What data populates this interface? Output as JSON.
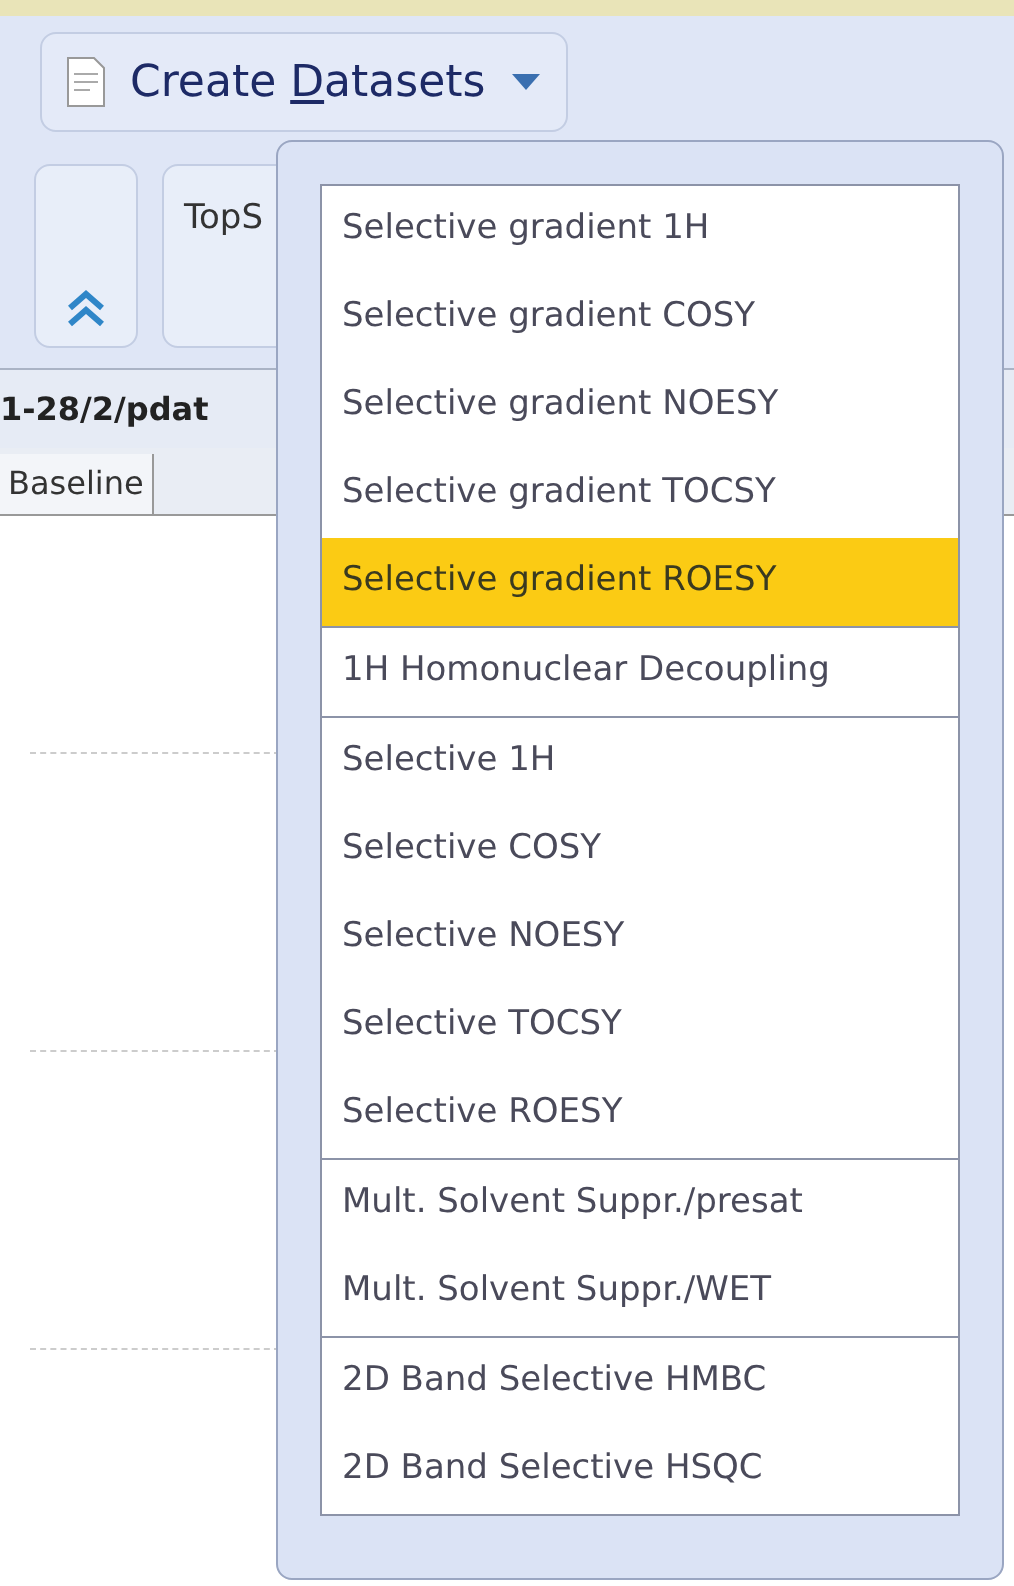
{
  "menu_button": {
    "title_before": "Create ",
    "mnemonic": "D",
    "title_after": "atasets"
  },
  "toolbar": {
    "panel_label": "TopS"
  },
  "path": "1-28/2/pdat",
  "tabs": [
    {
      "label": "Baseline",
      "selected": false
    }
  ],
  "menu": {
    "sections": [
      {
        "items": [
          {
            "label": "Selective gradient 1H",
            "selected": false
          },
          {
            "label": "Selective gradient COSY",
            "selected": false
          },
          {
            "label": "Selective gradient NOESY",
            "selected": false
          },
          {
            "label": "Selective gradient TOCSY",
            "selected": false
          },
          {
            "label": "Selective gradient ROESY",
            "selected": true
          }
        ]
      },
      {
        "items": [
          {
            "label": "1H Homonuclear Decoupling",
            "selected": false
          }
        ]
      },
      {
        "items": [
          {
            "label": "Selective 1H",
            "selected": false
          },
          {
            "label": "Selective COSY",
            "selected": false
          },
          {
            "label": "Selective NOESY",
            "selected": false
          },
          {
            "label": "Selective TOCSY",
            "selected": false
          },
          {
            "label": "Selective ROESY",
            "selected": false
          }
        ]
      },
      {
        "items": [
          {
            "label": "Mult. Solvent Suppr./presat",
            "selected": false
          },
          {
            "label": "Mult. Solvent Suppr./WET",
            "selected": false
          }
        ]
      },
      {
        "items": [
          {
            "label": "2D Band Selective HMBC",
            "selected": false
          },
          {
            "label": "2D Band Selective HSQC",
            "selected": false
          }
        ]
      }
    ]
  }
}
